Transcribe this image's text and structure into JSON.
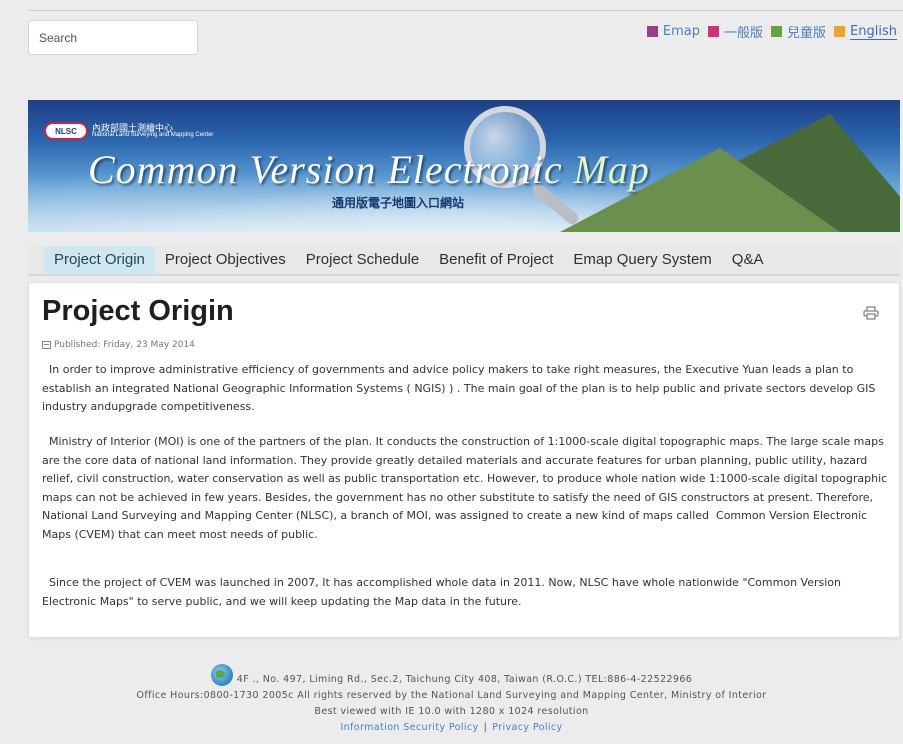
{
  "search": {
    "placeholder": "Search"
  },
  "languages": [
    {
      "label": "Emap",
      "color": "#9b3d8f"
    },
    {
      "label": "一般版",
      "color": "#d3307a"
    },
    {
      "label": "兒童版",
      "color": "#63a63a"
    },
    {
      "label": "English",
      "color": "#f0a22a"
    }
  ],
  "banner": {
    "badge": "NLSC",
    "org_zh": "內政部國土測繪中心",
    "org_en": "National Land Surveying and Mapping Center",
    "title_main": "Common Version Electronic",
    "title_map": "Map",
    "subtitle_zh": "通用版電子地圖入口網站"
  },
  "nav": {
    "items": [
      "Project Origin",
      "Project Objectives",
      "Project Schedule",
      "Benefit of Project",
      "Emap Query System",
      "Q&A"
    ],
    "active_index": 0
  },
  "article": {
    "title": "Project Origin",
    "published": "Published: Friday, 23 May 2014",
    "paragraphs": [
      "  In order to improve administrative efficiency of governments and advice policy makers to take right measures, the Executive Yuan leads a plan to establish an integrated National Geographic Information Systems ( NGIS) ) . The main goal of the plan is to help public and private sectors develop GIS industry andupgrade competitiveness.",
      "  Ministry of Interior (MOI) is one of the partners of the plan. It conducts the construction of 1:1000-scale digital topographic maps. The large scale maps are the core data of national land information. They provide greatly detailed materials and accurate features for urban planning, public utility, hazard relief, civil construction, water conservation as well as public transportation etc. However, to produce whole nation wide 1:1000-scale digital topographic maps can not be achieved in few years. Besides, the government has no other substitute to satisfy the need of GIS constructors at present. Therefore, National Land Surveying and Mapping Center (NLSC), a branch of MOI, was assigned to create a new kind of maps called  Common Version Electronic Maps (CVEM) that can meet most needs of public.",
      "  Since the project of CVEM was launched in 2007, It has accomplished whole data in 2011. Now, NLSC have whole nationwide \"Common Version Electronic Maps\" to serve public, and we will keep updating the Map data in the future."
    ]
  },
  "footer": {
    "address": "4F ., No. 497, Liming Rd., Sec.2, Taichung City 408, Taiwan (R.O.C.) TEL:886-4-22522966",
    "hours": "Office Hours:0800-1730 2005c All rights reserved by the National Land Surveying and Mapping Center, Ministry of Interior",
    "best_viewed": "Best viewed with IE 10.0 with 1280 x 1024 resolution",
    "link_security": "Information Security Policy",
    "separator": "|",
    "link_privacy": "Privacy Policy"
  }
}
